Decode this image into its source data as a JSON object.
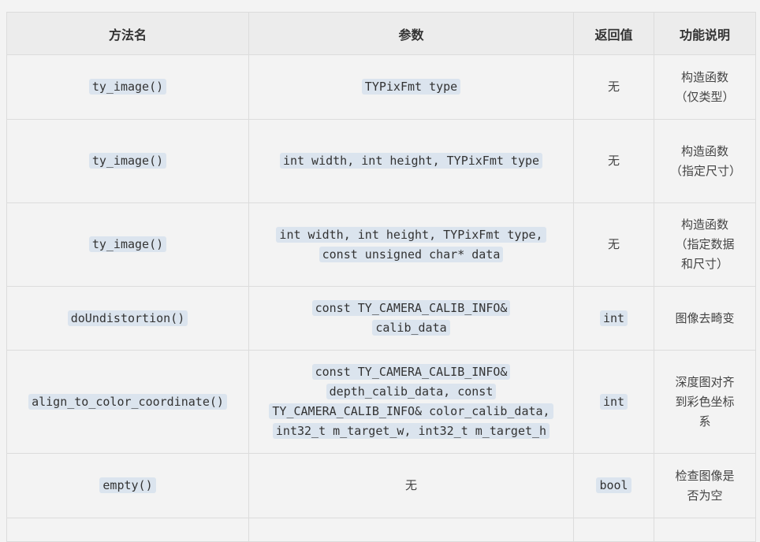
{
  "table": {
    "headers": [
      "方法名",
      "参数",
      "返回值",
      "功能说明"
    ],
    "rows": [
      {
        "method": "ty_image()",
        "params": "TYPixFmt type",
        "params_is_code": true,
        "return": "无",
        "return_is_code": false,
        "desc": "构造函数（仅类型）"
      },
      {
        "method": "ty_image()",
        "params": "int width, int height, TYPixFmt type",
        "params_is_code": true,
        "return": "无",
        "return_is_code": false,
        "desc": "构造函数（指定尺寸）"
      },
      {
        "method": "ty_image()",
        "params_lines": [
          "int width, int height, TYPixFmt type,",
          "const unsigned char* data"
        ],
        "params_is_code": true,
        "return": "无",
        "return_is_code": false,
        "desc": "构造函数（指定数据和尺寸）"
      },
      {
        "method": "doUndistortion()",
        "params_lines": [
          "const TY_CAMERA_CALIB_INFO&",
          "calib_data"
        ],
        "params_is_code": true,
        "return": "int",
        "return_is_code": true,
        "desc": "图像去畸变"
      },
      {
        "method": "align_to_color_coordinate()",
        "params_lines": [
          "const TY_CAMERA_CALIB_INFO&",
          "depth_calib_data, const",
          "TY_CAMERA_CALIB_INFO& color_calib_data,",
          "int32_t m_target_w, int32_t m_target_h"
        ],
        "params_is_code": true,
        "return": "int",
        "return_is_code": true,
        "desc": "深度图对齐到彩色坐标系"
      },
      {
        "method": "empty()",
        "params": "无",
        "params_is_code": false,
        "return": "bool",
        "return_is_code": true,
        "desc": "检查图像是否为空"
      }
    ]
  }
}
